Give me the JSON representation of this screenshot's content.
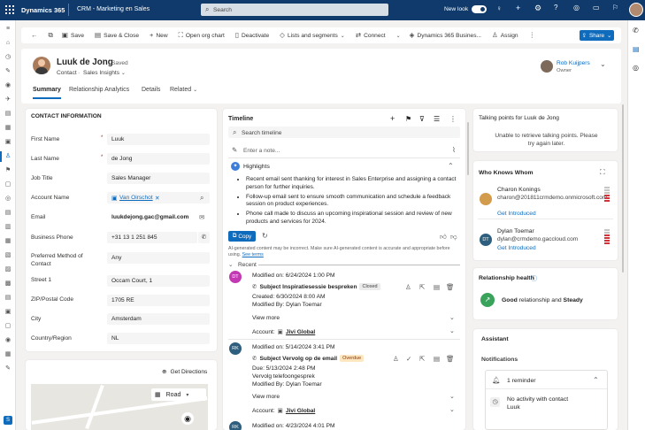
{
  "app": {
    "name": "Dynamics 365",
    "area": "CRM - Marketing en Sales",
    "search_placeholder": "Search",
    "new_look": "New look"
  },
  "commands": [
    "Save",
    "Save & Close",
    "New",
    "Open org chart",
    "Deactivate",
    "Lists and segments",
    "Connect",
    "Dynamics 365 Busines...",
    "Assign"
  ],
  "share": "Share",
  "record": {
    "name": "Luuk de Jong",
    "saved": "- Saved",
    "entity": "Contact",
    "form": "Sales Insights",
    "owner_name": "Rob Kuijpers",
    "owner_label": "Owner"
  },
  "tabs": [
    "Summary",
    "Relationship Analytics",
    "Details",
    "Related"
  ],
  "contact": {
    "title": "CONTACT INFORMATION",
    "fields": [
      {
        "label": "First Name",
        "value": "Luuk"
      },
      {
        "label": "Last Name",
        "value": "de Jong"
      },
      {
        "label": "Job Title",
        "value": "Sales Manager"
      },
      {
        "label": "Account Name",
        "value": "Van Oirschot"
      },
      {
        "label": "Email",
        "value": "luukdejong.gac@gmail.com"
      },
      {
        "label": "Business Phone",
        "value": "+31 13 1 251 845"
      },
      {
        "label": "Preferred Method of Contact",
        "value": "Any"
      },
      {
        "label": "Street 1",
        "value": "Occam Court, 1"
      },
      {
        "label": "ZIP/Postal Code",
        "value": "1705 RE"
      },
      {
        "label": "City",
        "value": "Amsterdam"
      },
      {
        "label": "Country/Region",
        "value": "NL"
      }
    ],
    "get_directions": "Get Directions",
    "map_mode": "Road"
  },
  "timeline": {
    "title": "Timeline",
    "search_placeholder": "Search timeline",
    "note_placeholder": "Enter a note...",
    "highlights_title": "Highlights",
    "highlights": [
      "Recent email sent thanking for interest in Sales Enterprise and assigning a contact person for further inquiries.",
      "Follow-up email sent to ensure smooth communication and schedule a feedback session on product experiences.",
      "Phone call made to discuss an upcoming inspirational session and review of new products and services for 2024."
    ],
    "copy": "Copy",
    "disclaimer": "AI-generated content may be incorrect. Make sure AI-generated content is accurate and appropriate before using.",
    "see_terms": "See terms",
    "recent": "Recent",
    "items": [
      {
        "initials": "DT",
        "color": "#c239b3",
        "modified": "Modified on: 6/24/2024 1:00 PM",
        "subject": "Subject Inspiratiesessie bespreken",
        "status": "Closed",
        "line1": "Created: 6/30/2024 8:00 AM",
        "line2": "Modified By: Dylan Toemar",
        "line3": "",
        "view_more": "View more",
        "account_label": "Account:",
        "account": "Jivi Global"
      },
      {
        "initials": "RK",
        "color": "#2e5f7e",
        "modified": "Modified on: 5/14/2024 3:41 PM",
        "subject": "Subject Vervolg op de email",
        "status": "Overdue",
        "line1": "Due: 5/13/2024 2:48 PM",
        "line2": "Vervolg telefoongesprek",
        "line3": "Modified By: Dylan Toemar",
        "view_more": "View more",
        "account_label": "Account:",
        "account": "Jivi Global"
      },
      {
        "initials": "RK",
        "modified": "Modified on: 4/23/2024 4:01 PM"
      }
    ]
  },
  "talking": {
    "title": "Talking points for Luuk de Jong",
    "msg": "Unable to retrieve talking points. Please try again later."
  },
  "who": {
    "title": "Who Knows Whom",
    "people": [
      {
        "name": "Charon Konings",
        "email": "charon@201811crmdemo.onmicrosoft.com",
        "cta": "Get Introduced"
      },
      {
        "name": "Dylan Toemar",
        "email": "dylan@crmdemo.gaccloud.com",
        "cta": "Get Introduced",
        "initials": "DT"
      }
    ]
  },
  "health": {
    "title": "Relationship health",
    "good": "Good",
    "mid": "relationship and",
    "steady": "Steady"
  },
  "assistant": {
    "title": "Assistant",
    "notifications": "Notifications",
    "reminder": "1 reminder",
    "item_title": "No activity with contact",
    "item_name": "Luuk"
  },
  "colors": {
    "topbar": "#0f3a6b",
    "accent": "#0f6cbd",
    "overdue": "#fde7c1"
  }
}
